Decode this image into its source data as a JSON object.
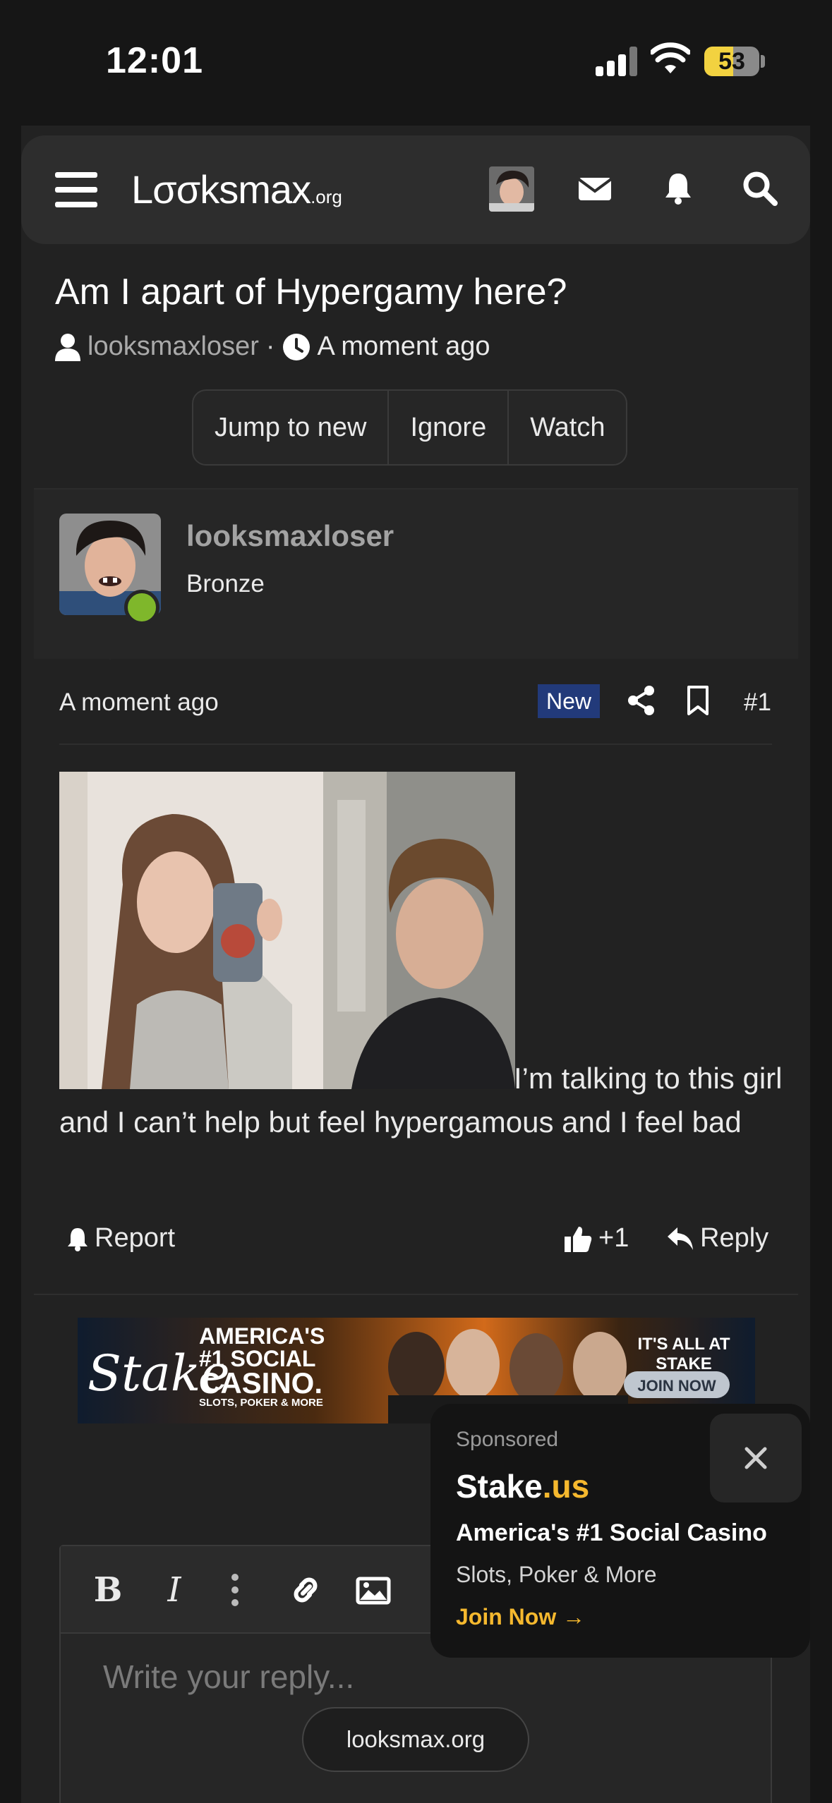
{
  "status_bar": {
    "time": "12:01",
    "battery": "53"
  },
  "nav": {
    "logo_main": "Lσσksmax",
    "logo_suffix": ".org"
  },
  "thread": {
    "title": "Am I apart of Hypergamy here?",
    "author": "looksmaxloser",
    "time": "A moment ago",
    "buttons": [
      "Jump to new",
      "Ignore",
      "Watch"
    ]
  },
  "post": {
    "username": "looksmaxloser",
    "user_title": "Bronze",
    "time": "A moment ago",
    "badge": "New",
    "number": "#1",
    "body": "I’m talking to this girl and I can’t help but feel hypergamous and I feel bad",
    "report": "Report",
    "reactions": "+1",
    "reply": "Reply"
  },
  "ad_banner": {
    "brand": "Stake",
    "line1": "AMERICA'S",
    "line2": "#1 SOCIAL",
    "line3": "CASINO.",
    "line4": "SLOTS, POKER & MORE",
    "tagline": "IT'S ALL AT STAKE",
    "cta": "JOIN NOW"
  },
  "editor": {
    "placeholder": "Write your reply..."
  },
  "url_pill": "looksmax.org",
  "popup": {
    "sponsored": "Sponsored",
    "brand_main": "Stake",
    "brand_suffix": ".us",
    "headline": "America's #1 Social Casino",
    "sub": "Slots, Poker & More",
    "cta": "Join Now →"
  },
  "colors": {
    "accent_new": "#223a7a",
    "online": "#7fb72b",
    "stake_gold": "#f5b82e"
  }
}
